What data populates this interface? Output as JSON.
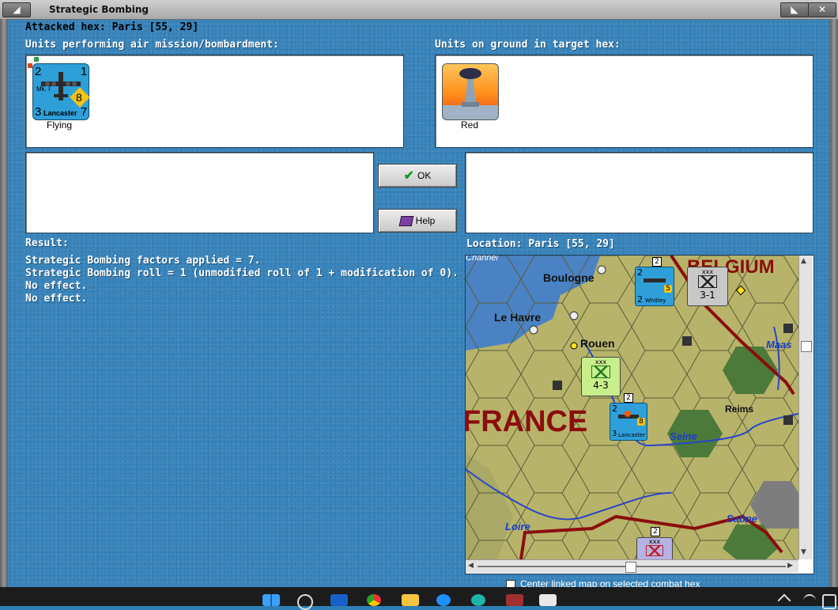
{
  "window": {
    "title": "Strategic Bombing",
    "attacked_hex_label": "Attacked hex: Paris  [55, 29]"
  },
  "air_panel": {
    "header": "Units performing air mission/bombardment:",
    "unit": {
      "top_left": "2",
      "top_right": "1",
      "bottom_left": "3",
      "bottom_right": "7",
      "mark": "Mk. I",
      "name": "Lancaster",
      "badge": "8",
      "caption": "Flying"
    }
  },
  "ground_panel": {
    "header": "Units on ground in target hex:",
    "unit": {
      "caption": "Red"
    }
  },
  "buttons": {
    "ok_label": "OK",
    "help_label": "Help"
  },
  "result": {
    "header": "Result:",
    "lines": [
      "Strategic Bombing factors applied = 7.",
      "Strategic Bombing roll = 1 (unmodified roll of 1 + modification of 0).",
      "No effect.",
      "No effect."
    ]
  },
  "location": {
    "label": "Location:  Paris  [55, 29]"
  },
  "map": {
    "labels": {
      "channel": "Channel",
      "belgium": "BELGIUM",
      "boulogne": "Boulogne",
      "le_havre": "Le Havre",
      "rouen": "Rouen",
      "france": "FRANCE",
      "reims": "Reims",
      "seine": "Seine",
      "maas": "Maas",
      "loire": "Loire",
      "saone": "Saône"
    },
    "counters": {
      "whitley_name": "Whitley",
      "whitley_tl": "2",
      "whitley_bl": "2",
      "whitley_badge": "5",
      "whitley_stack": "2",
      "ger_size": "xxx",
      "ger_value": "3-1",
      "fr_size": "xxx",
      "fr_value": "4-3",
      "lanc_name": "Lancaster",
      "lanc_tl": "2",
      "lanc_bl": "3",
      "lanc_badge": "8",
      "lanc_stack": "2",
      "bottom_size": "xxx",
      "bottom_stack": "2"
    }
  },
  "checkbox": {
    "label": "Center linked map on selected combat hex"
  },
  "colors": {
    "background": "#3a86bd",
    "air_counter": "#2e9fd8",
    "german_counter": "#c8c8c8",
    "french_counter": "#c9ee8c",
    "border_red": "#8b0d0d"
  }
}
